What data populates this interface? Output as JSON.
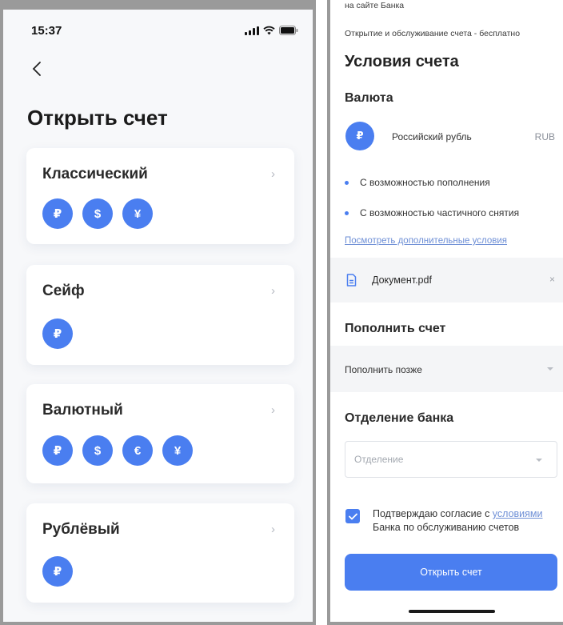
{
  "left": {
    "status_time": "15:37",
    "title": "Открыть счет",
    "cards": [
      {
        "title": "Классический",
        "currencies": [
          "₽",
          "$",
          "¥"
        ]
      },
      {
        "title": "Сейф",
        "currencies": [
          "₽"
        ]
      },
      {
        "title": "Валютный",
        "currencies": [
          "₽",
          "$",
          "€",
          "¥"
        ]
      },
      {
        "title": "Рублёвый",
        "currencies": [
          "₽"
        ]
      }
    ]
  },
  "right": {
    "top_note": "на сайте Банка",
    "opening_note": "Открытие и обслуживание счета - бесплатно",
    "conditions_title": "Условия счета",
    "currency_title": "Валюта",
    "currency": {
      "symbol": "₽",
      "name": "Российский рубль",
      "code": "RUB"
    },
    "features": [
      "С возможностью пополнения",
      "С возможностью частичного снятия"
    ],
    "more_conditions_link": "Посмотреть дополнительные условия",
    "document_name": "Документ.pdf",
    "document_close": "×",
    "topup_title": "Пополнить счет",
    "topup_value": "Пополнить позже",
    "branch_title": "Отделение банка",
    "branch_placeholder": "Отделение",
    "consent": {
      "before": "Подтверждаю согласие с ",
      "link": "условиями",
      "after": " Банка по обслуживанию счетов",
      "checked": true
    },
    "submit_label": "Открыть счет"
  },
  "colors": {
    "accent": "#4a7ef0",
    "link": "#6e8fd6",
    "surface": "#f4f5f7"
  }
}
